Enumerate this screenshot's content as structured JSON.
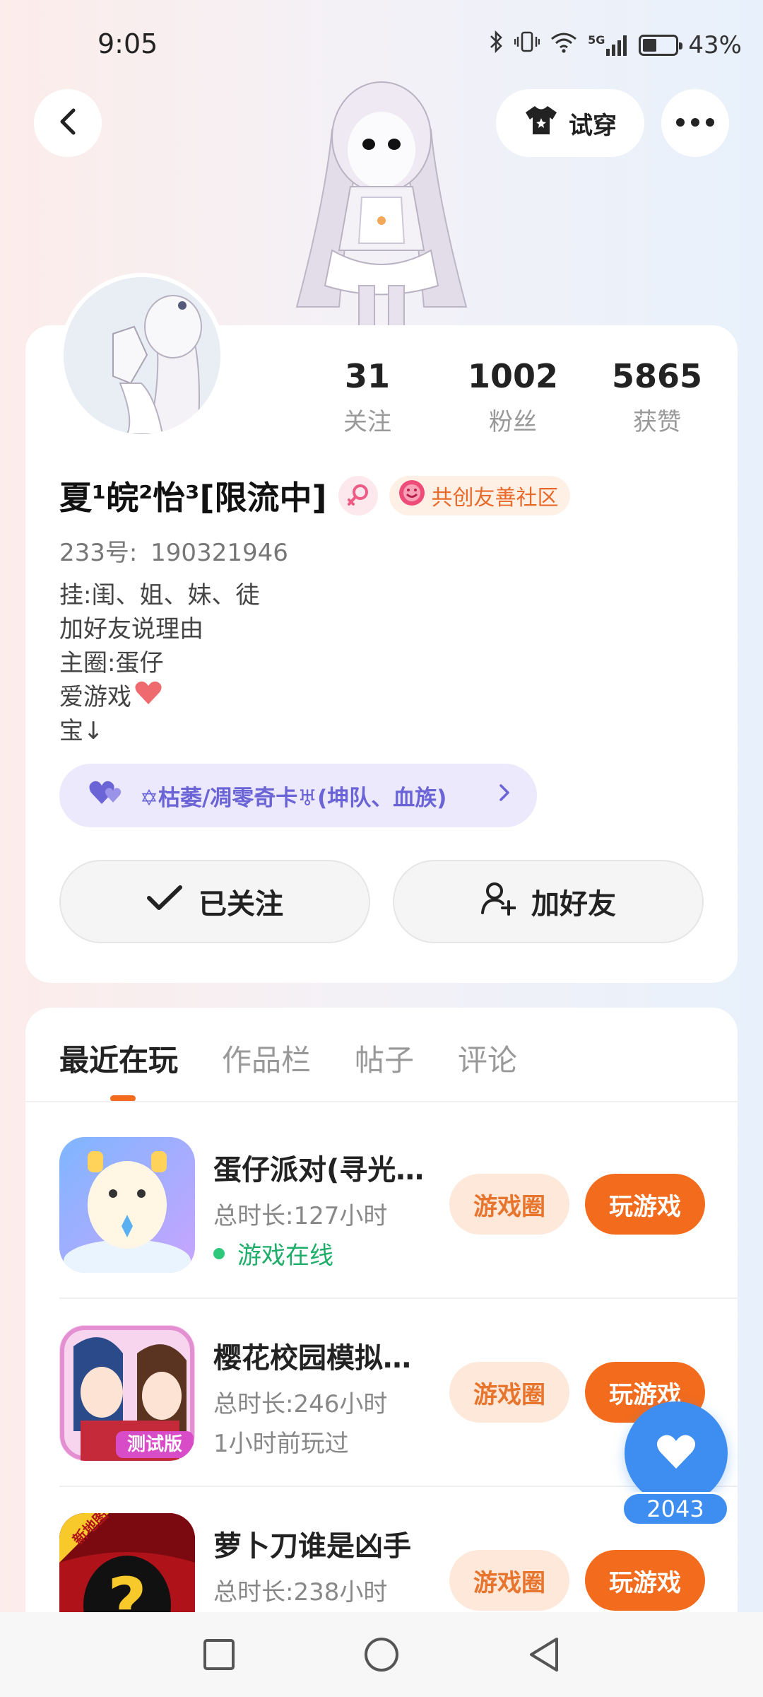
{
  "status_bar": {
    "time": "9:05",
    "battery": "43%",
    "network": "5G",
    "battery_level": 0.43
  },
  "header": {
    "try_on_label": "试穿"
  },
  "profile": {
    "stats": [
      {
        "value": "31",
        "label": "关注"
      },
      {
        "value": "1002",
        "label": "粉丝"
      },
      {
        "value": "5865",
        "label": "获赞"
      }
    ],
    "name": "夏¹皖²怡³[限流中]",
    "community_badge": "共创友善社区",
    "uid_label": "233号:",
    "uid_value": "190321946",
    "bio_lines": [
      "挂:闺、姐、妹、徒",
      "加好友说理由",
      "主圈:蛋仔",
      "爱游戏",
      "宝↓"
    ],
    "guild": "✡枯萎/凋零奇卡♅(坤队、血族)",
    "follow_button": "已关注",
    "add_friend_button": "加好友"
  },
  "tabs": [
    "最近在玩",
    "作品栏",
    "帖子",
    "评论"
  ],
  "games": [
    {
      "title": "蛋仔派对(寻光…",
      "time": "总时长:127小时",
      "status": "游戏在线",
      "online": true
    },
    {
      "title": "樱花校园模拟…",
      "time": "总时长:246小时",
      "status": "1小时前玩过",
      "online": false,
      "icon_tag": "测试版"
    },
    {
      "title": "萝卜刀谁是凶手",
      "time": "总时长:238小时",
      "status": "",
      "online": false,
      "icon_tag": "新地图"
    }
  ],
  "buttons": {
    "circle": "游戏圈",
    "play": "玩游戏"
  },
  "like": {
    "count": "2043"
  },
  "colors": {
    "accent": "#f36b1c",
    "like_blue": "#3d8ef0",
    "guild_purple": "#6b64d6"
  }
}
